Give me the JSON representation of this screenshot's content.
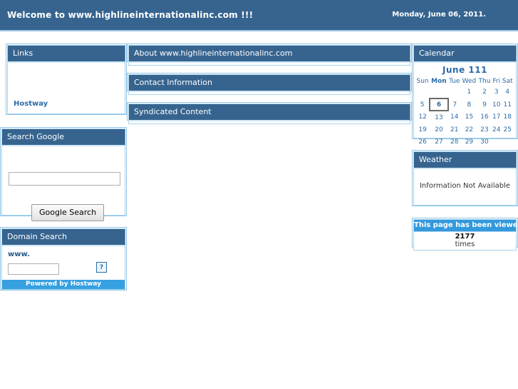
{
  "header": {
    "welcome_text": "Welcome to www.highlineinternationalinc.com !!!",
    "date_text": "Monday, June 06, 2011.",
    "bg_color": "#36648f"
  },
  "sidebar": {
    "links_panel": {
      "title": "Links",
      "items": [
        {
          "label": "Hostway"
        }
      ]
    },
    "google_panel": {
      "title": "Search Google",
      "input_value": "",
      "input_placeholder": "",
      "button_label": "Google Search"
    },
    "domain_panel": {
      "title": "Domain Search",
      "www_label": "www.",
      "input_value": "",
      "input_placeholder": "",
      "help_label": "?",
      "footer_label": "Powered by Hostway",
      "footer_color": "#36a0e0"
    }
  },
  "main": {
    "bars": [
      {
        "title": "About www.highlineinternationalinc.com"
      },
      {
        "title": "Contact Information"
      },
      {
        "title": "Syndicated Content"
      }
    ]
  },
  "right": {
    "calendar": {
      "title": "Calendar",
      "month_label": "June 111",
      "weekdays": [
        "Sun",
        "Mon",
        "Tue",
        "Wed",
        "Thu",
        "Fri",
        "Sat"
      ],
      "today_weekday_index": 1,
      "today": 6,
      "weeks": [
        [
          "",
          "",
          "",
          "1",
          "2",
          "3",
          "4"
        ],
        [
          "5",
          "6",
          "7",
          "8",
          "9",
          "10",
          "11"
        ],
        [
          "12",
          "13",
          "14",
          "15",
          "16",
          "17",
          "18"
        ],
        [
          "19",
          "20",
          "21",
          "22",
          "23",
          "24",
          "25"
        ],
        [
          "26",
          "27",
          "28",
          "29",
          "30",
          "",
          ""
        ]
      ]
    },
    "weather": {
      "title": "Weather",
      "message": "Information Not Available"
    },
    "counter": {
      "title": "This page has been viewed",
      "count": "2177",
      "unit": "times",
      "header_color": "#3399dd"
    }
  }
}
